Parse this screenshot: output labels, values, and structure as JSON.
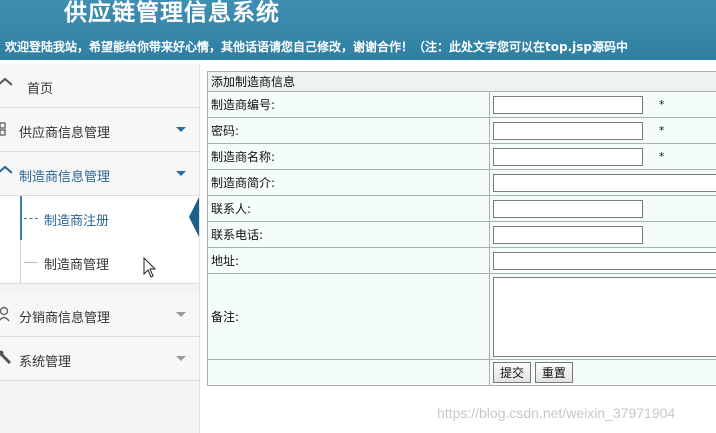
{
  "header": {
    "title": "供应链管理信息系统",
    "marquee": "欢迎登陆我站，希望能给你带来好心情，其他话语请您自己修改，谢谢合作！（注：此处文字您可以在top.jsp源码中"
  },
  "sidebar": {
    "items": [
      {
        "label": "首页",
        "icon": "home-icon"
      },
      {
        "label": "供应商信息管理",
        "icon": "supplier-icon"
      },
      {
        "label": "制造商信息管理",
        "icon": "manufacturer-icon"
      },
      {
        "label": "分销商信息管理",
        "icon": "distributor-icon"
      },
      {
        "label": "系统管理",
        "icon": "wrench-icon"
      }
    ],
    "sub_items": [
      {
        "label": "制造商注册"
      },
      {
        "label": "制造商管理"
      }
    ]
  },
  "form": {
    "caption": "添加制造商信息",
    "fields": [
      {
        "label": "制造商编号:",
        "value": "",
        "required": "*"
      },
      {
        "label": "密码:",
        "value": "",
        "required": "*"
      },
      {
        "label": "制造商名称:",
        "value": "",
        "required": "*"
      },
      {
        "label": "制造商简介:",
        "value": ""
      },
      {
        "label": "联系人:",
        "value": ""
      },
      {
        "label": "联系电话:",
        "value": ""
      },
      {
        "label": "地址:",
        "value": ""
      },
      {
        "label": "备注:",
        "value": ""
      }
    ],
    "submit_label": "提交",
    "reset_label": "重置"
  },
  "watermark": "https://blog.csdn.net/weixin_37971904",
  "colors": {
    "header_bg": "#3a8bb0",
    "accent": "#2a6593",
    "form_bg": "#f5fdf8"
  }
}
